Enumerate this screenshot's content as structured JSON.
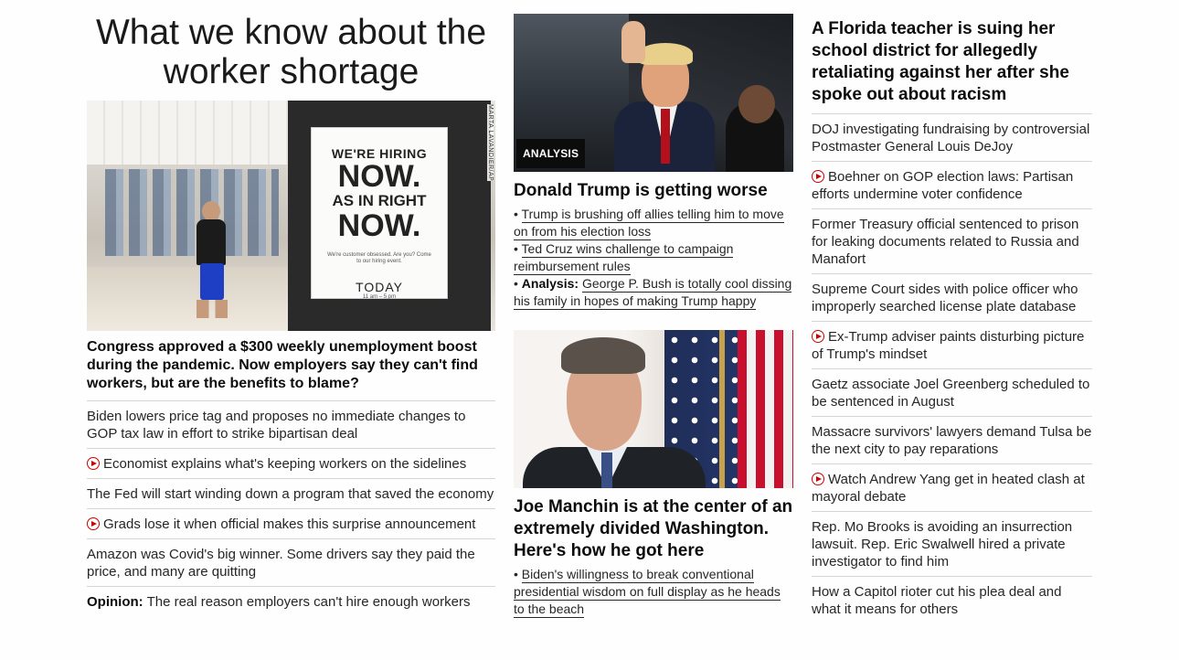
{
  "left": {
    "headline": "What we know about the worker shortage",
    "photo": {
      "sign_line1": "WE'RE HIRING",
      "sign_line2": "NOW.",
      "sign_line3": "AS IN RIGHT",
      "sign_line4": "NOW.",
      "sign_small": "We're customer obsessed. Are you? Come to our hiring event.",
      "sign_today": "TODAY",
      "sign_hours": "11 am – 5 pm",
      "credit": "MARTA LAVANDIER/AP"
    },
    "lead": "Congress approved a $300 weekly unemployment boost during the pandemic. Now employers say they can't find workers, but are the benefits to blame?",
    "items": [
      {
        "text": "Biden lowers price tag and proposes no immediate changes to GOP tax law in effort to strike bipartisan deal",
        "video": false
      },
      {
        "text": "Economist explains what's keeping workers on the sidelines",
        "video": true
      },
      {
        "text": "The Fed will start winding down a program that saved the economy",
        "video": false
      },
      {
        "text": "Grads lose it when official makes this surprise announcement",
        "video": true
      },
      {
        "text": "Amazon was Covid's big winner. Some drivers say they paid the price, and many are quitting",
        "video": false
      }
    ],
    "opinion": {
      "label": "Opinion:",
      "text": "The real reason employers can't hire enough workers"
    }
  },
  "middle": {
    "story1": {
      "badge": "ANALYSIS",
      "headline": "Donald Trump is getting worse",
      "bullets": [
        {
          "prefix": "",
          "text": "Trump is brushing off allies telling him to move on from his election loss"
        },
        {
          "prefix": "",
          "text": "Ted Cruz wins challenge to campaign reimbursement rules"
        },
        {
          "prefix": "Analysis:",
          "text": "George P. Bush is totally cool dissing his family in hopes of making Trump happy"
        }
      ]
    },
    "story2": {
      "headline": "Joe Manchin is at the center of an extremely divided Washington. Here's how he got here",
      "bullets": [
        {
          "prefix": "",
          "text": "Biden's willingness to break conventional presidential wisdom on full display as he heads to the beach"
        }
      ]
    }
  },
  "right": {
    "headline": "A Florida teacher is suing her school district for allegedly retaliating against her after she spoke out about racism",
    "items": [
      {
        "text": "DOJ investigating fundraising by controversial Postmaster General Louis DeJoy",
        "video": false
      },
      {
        "text": "Boehner on GOP election laws: Partisan efforts undermine voter confidence",
        "video": true
      },
      {
        "text": "Former Treasury official sentenced to prison for leaking documents related to Russia and Manafort",
        "video": false
      },
      {
        "text": "Supreme Court sides with police officer who improperly searched license plate database",
        "video": false
      },
      {
        "text": "Ex-Trump adviser paints disturbing picture of Trump's mindset",
        "video": true
      },
      {
        "text": "Gaetz associate Joel Greenberg scheduled to be sentenced in August",
        "video": false
      },
      {
        "text": "Massacre survivors' lawyers demand Tulsa be the next city to pay reparations",
        "video": false
      },
      {
        "text": "Watch Andrew Yang get in heated clash at mayoral debate",
        "video": true
      },
      {
        "text": "Rep. Mo Brooks is avoiding an insurrection lawsuit. Rep. Eric Swalwell hired a private investigator to find him",
        "video": false
      },
      {
        "text": "How a Capitol rioter cut his plea deal and what it means for others",
        "video": false
      }
    ]
  },
  "colors": {
    "video_icon": "#cc0000",
    "divider": "#d5d5d5",
    "badge_bg": "#0c0c0c"
  }
}
